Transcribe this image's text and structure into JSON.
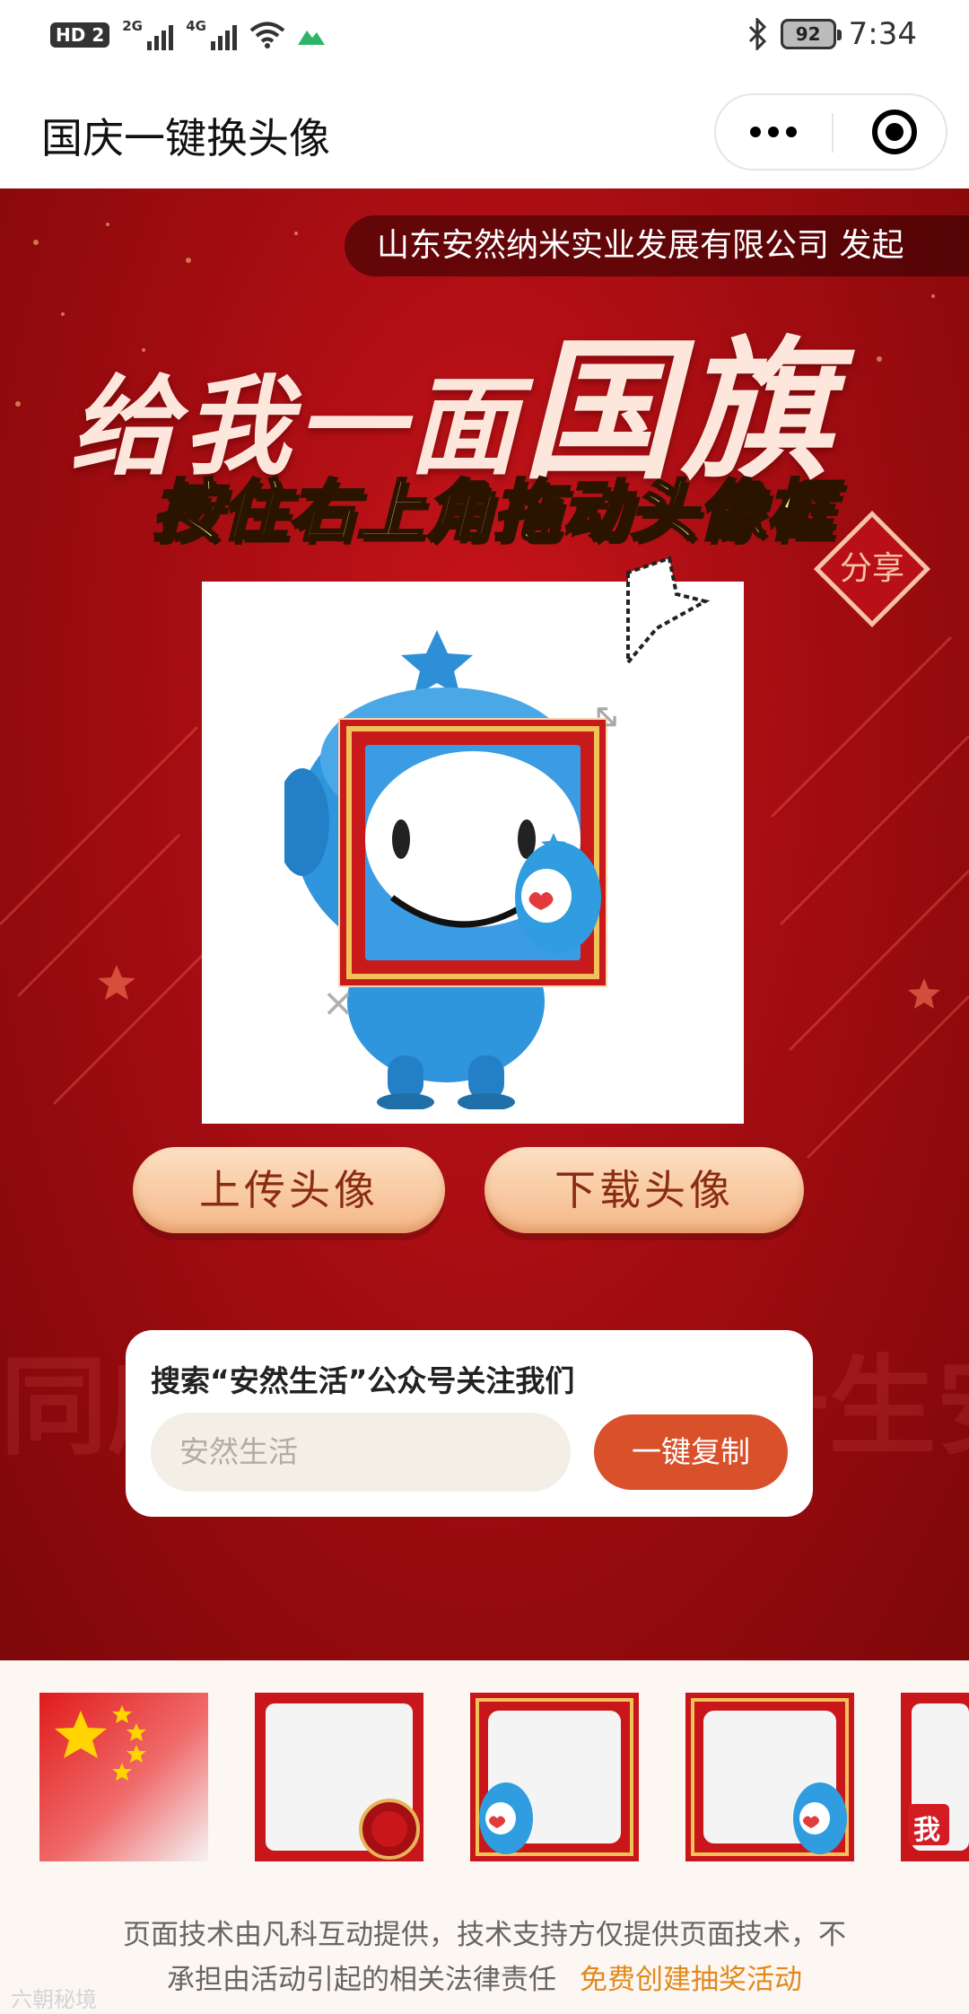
{
  "status_bar": {
    "hd": "HD",
    "sim_index": "2",
    "signal_a_label": "2G",
    "signal_b_label": "4G",
    "battery": "92",
    "time": "7:34"
  },
  "nav": {
    "title": "国庆一键换头像"
  },
  "hero": {
    "sponsor": "山东安然纳米实业发展有限公司 发起",
    "headline_small": "给我一面",
    "headline_big": "国旗",
    "instruction": "按住右上角拖动头像框",
    "share_badge": "分享",
    "upload_label": "上传头像",
    "download_label": "下载头像",
    "bg_words": "同庆 安然一生 一生安然"
  },
  "follow": {
    "title": "搜索“安然生活”公众号关注我们",
    "input_placeholder": "安然生活",
    "copy_label": "一键复制"
  },
  "footer": {
    "line1": "页面技术由凡科互动提供，技术支持方仅提供页面技术，不",
    "line2": "承担由活动引起的相关法律责任",
    "link": "免费创建抽奖活动",
    "watermark": "六朝秘境"
  },
  "frame_thumbs": [
    {
      "name": "national-flag-frame"
    },
    {
      "name": "centenary-badge-frame"
    },
    {
      "name": "mascot-frame-a"
    },
    {
      "name": "mascot-frame-b"
    },
    {
      "name": "wo-ai-frame",
      "text": "我"
    }
  ],
  "colors": {
    "hero_red": "#a50d12",
    "button_gradient_top": "#fde0c4",
    "button_gradient_bottom": "#f4b786",
    "copy_button": "#d9512b",
    "footer_link": "#e2891c"
  }
}
